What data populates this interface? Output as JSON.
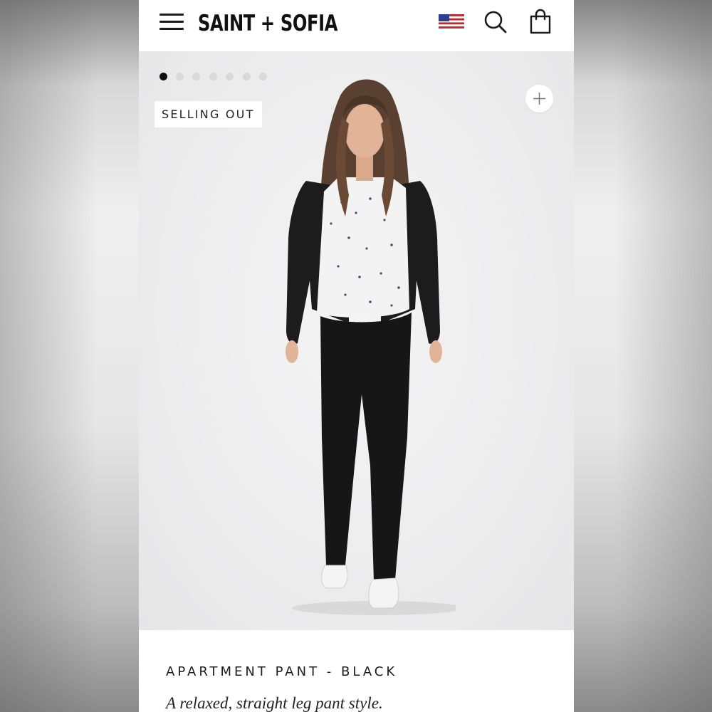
{
  "header": {
    "logo": "SAINT + SOFIA",
    "menu_icon": "hamburger-menu-icon",
    "flag_icon": "us-flag-icon",
    "search_icon": "search-icon",
    "cart_icon": "shopping-bag-icon"
  },
  "gallery": {
    "image_count": 7,
    "active_index": 0,
    "badge": "SELLING OUT",
    "zoom_icon": "plus-icon"
  },
  "product": {
    "title": "APARTMENT PANT - BLACK",
    "description": "A relaxed, straight leg pant style."
  },
  "colors": {
    "background": "#ffffff",
    "hero_bg": "#ededee",
    "text": "#1d1d1d",
    "dot_active": "#111111",
    "dot_inactive": "#d9d9d9"
  }
}
